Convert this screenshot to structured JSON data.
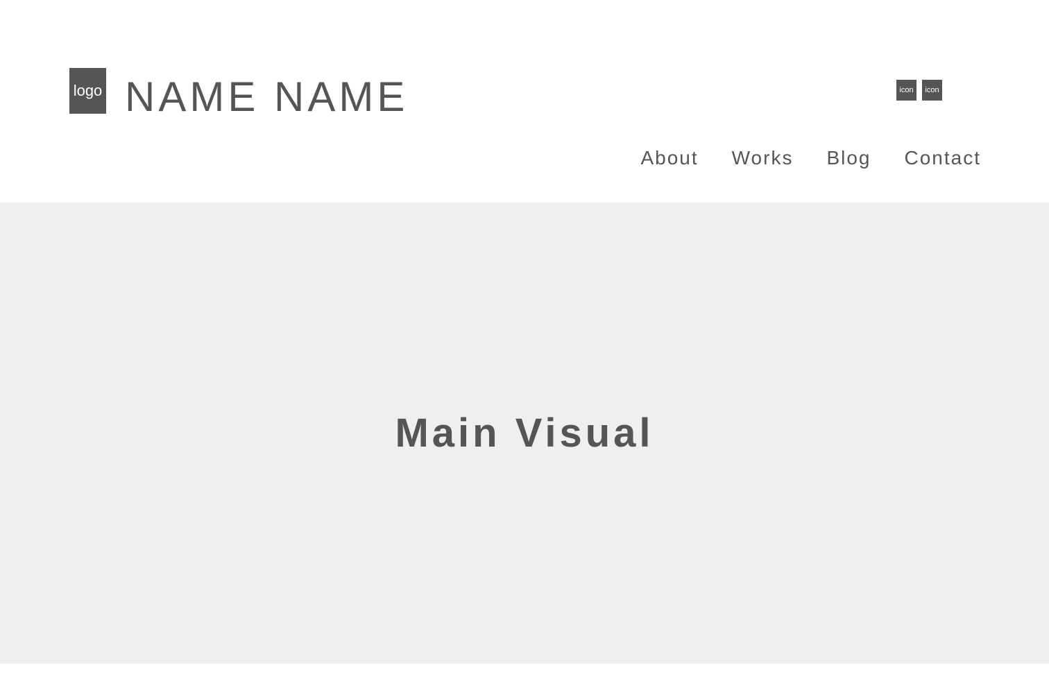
{
  "header": {
    "logo_label": "logo",
    "site_name": "NAME NAME",
    "icons": [
      {
        "label": "icon",
        "icon_name": "placeholder-icon"
      },
      {
        "label": "icon",
        "icon_name": "placeholder-icon"
      }
    ],
    "nav": [
      {
        "label": "About"
      },
      {
        "label": "Works"
      },
      {
        "label": "Blog"
      },
      {
        "label": "Contact"
      }
    ]
  },
  "main_visual": {
    "title": "Main Visual"
  },
  "colors": {
    "text": "#555555",
    "main_visual_bg": "#efefef",
    "page_bg": "#ffffff"
  }
}
